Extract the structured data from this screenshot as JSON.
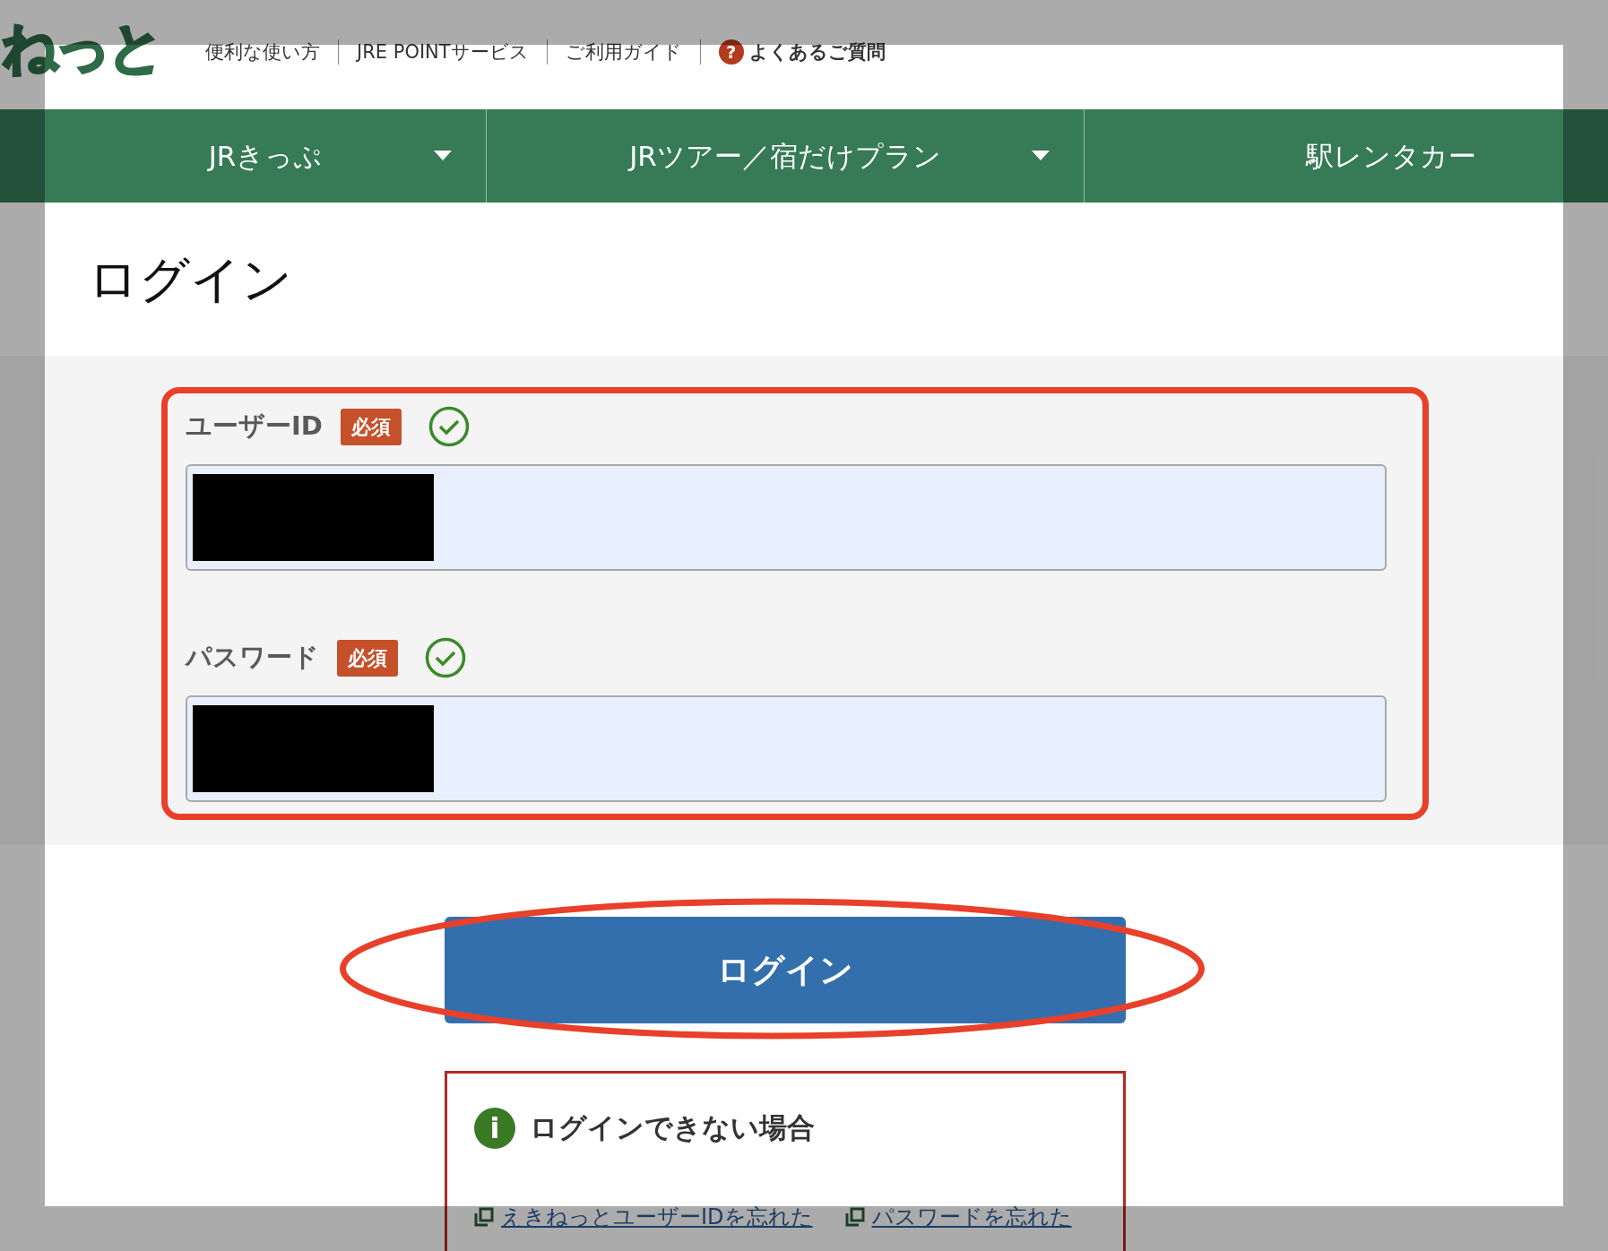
{
  "logo": {
    "text": "ねっと"
  },
  "top_links": [
    {
      "label": "便利な使い方",
      "kind": "plain"
    },
    {
      "label": "JRE POINTサービス",
      "kind": "plain"
    },
    {
      "label": "ご利用ガイド",
      "kind": "plain"
    },
    {
      "label": "よくあるご質問",
      "kind": "help",
      "icon": "?"
    }
  ],
  "nav": [
    {
      "label": "JRきっぷ",
      "dropdown": true
    },
    {
      "label": "JRツアー／宿だけプラン",
      "dropdown": true
    },
    {
      "label": "駅レンタカー",
      "dropdown": false
    }
  ],
  "page_title": "ログイン",
  "form": {
    "circled": true,
    "fields": [
      {
        "label": "ユーザーID",
        "badge": "必須",
        "valid": true,
        "redacted": true
      },
      {
        "label": "パスワード",
        "badge": "必須",
        "valid": true,
        "redacted": true
      }
    ]
  },
  "login_button": {
    "label": "ログイン",
    "circled": true
  },
  "help_box": {
    "title": "ログインできない場合",
    "icon": "i",
    "links": [
      "えきねっとユーザーIDを忘れた",
      "パスワードを忘れた"
    ]
  },
  "spotlight": true
}
